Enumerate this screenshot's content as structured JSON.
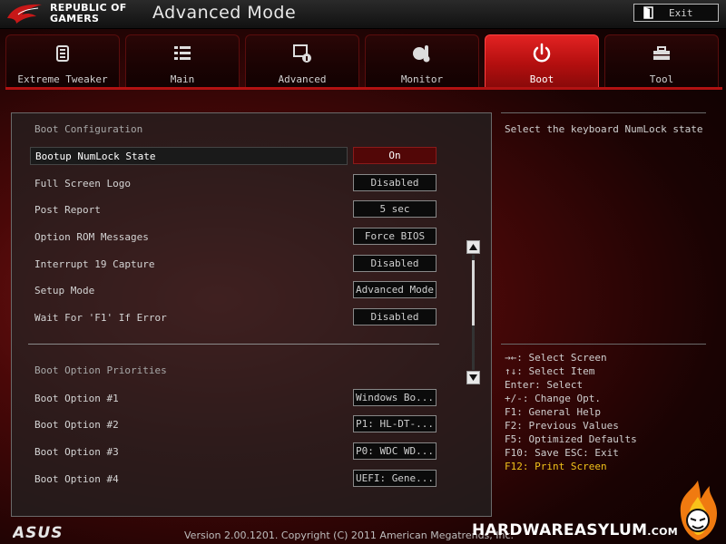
{
  "header": {
    "brand_line1": "REPUBLIC OF",
    "brand_line2": "GAMERS",
    "mode_title": "Advanced Mode",
    "exit_label": "Exit"
  },
  "tabs": [
    {
      "label": "Extreme Tweaker",
      "icon": "tweaker-icon",
      "active": false
    },
    {
      "label": "Main",
      "icon": "list-icon",
      "active": false
    },
    {
      "label": "Advanced",
      "icon": "advanced-icon",
      "active": false
    },
    {
      "label": "Monitor",
      "icon": "thermometer-icon",
      "active": false
    },
    {
      "label": "Boot",
      "icon": "power-icon",
      "active": true
    },
    {
      "label": "Tool",
      "icon": "toolbox-icon",
      "active": false
    }
  ],
  "boot_config": {
    "section_title": "Boot Configuration",
    "items": [
      {
        "label": "Bootup NumLock State",
        "value": "On"
      },
      {
        "label": "Full Screen Logo",
        "value": "Disabled"
      },
      {
        "label": "Post Report",
        "value": "5 sec"
      },
      {
        "label": "Option ROM Messages",
        "value": "Force BIOS"
      },
      {
        "label": "Interrupt 19 Capture",
        "value": "Disabled"
      },
      {
        "label": "Setup Mode",
        "value": "Advanced Mode"
      },
      {
        "label": "Wait For 'F1' If Error",
        "value": "Disabled"
      }
    ]
  },
  "boot_priorities": {
    "section_title": "Boot Option Priorities",
    "items": [
      {
        "label": "Boot Option #1",
        "value": "Windows Bo..."
      },
      {
        "label": "Boot Option #2",
        "value": "P1: HL-DT-..."
      },
      {
        "label": "Boot Option #3",
        "value": "P0: WDC WD..."
      },
      {
        "label": "Boot Option #4",
        "value": "UEFI: Gene..."
      }
    ]
  },
  "help": {
    "text": "Select the keyboard NumLock state"
  },
  "keys": [
    "→←: Select Screen",
    "↑↓: Select Item",
    "Enter: Select",
    "+/-: Change Opt.",
    "F1: General Help",
    "F2: Previous Values",
    "F5: Optimized Defaults",
    "F10: Save  ESC: Exit",
    "F12: Print Screen"
  ],
  "footer": {
    "asus_logo": "ASUS",
    "version": "Version 2.00.1201. Copyright (C) 2011 American Megatrends, Inc.",
    "watermark_main": "HARDWAREASYLUM",
    "watermark_suffix": ".COM"
  },
  "colors": {
    "accent_red": "#b11212",
    "active_tab": "#e22222",
    "highlight_key": "#f2c21a"
  }
}
